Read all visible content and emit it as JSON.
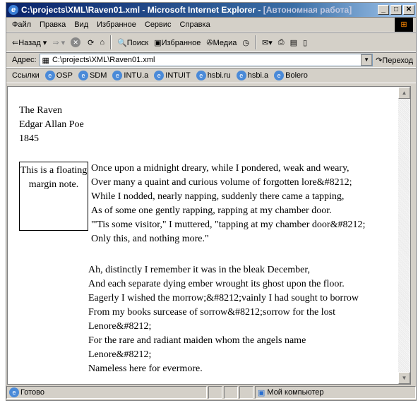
{
  "window": {
    "title": "C:\\projects\\XML\\Raven01.xml - Microsoft Internet Explorer - ",
    "title_suffix": "[Автономная работа]"
  },
  "menu": [
    "Файл",
    "Правка",
    "Вид",
    "Избранное",
    "Сервис",
    "Справка"
  ],
  "toolbar": {
    "back": "Назад",
    "search": "Поиск",
    "favorites": "Избранное",
    "media": "Медиа"
  },
  "address": {
    "label": "Адрес:",
    "value": "C:\\projects\\XML\\Raven01.xml",
    "go": "Переход"
  },
  "links": {
    "label": "Ссылки",
    "items": [
      "OSP",
      "SDM",
      "INTU.a",
      "INTUIT",
      "hsbi.ru",
      "hsbi.a",
      "Bolero"
    ]
  },
  "doc": {
    "title": "The Raven",
    "author": "Edgar Allan Poe",
    "year": "1845",
    "note": "This is a floating margin note.",
    "stanza1": [
      "Once upon a midnight dreary, while I pondered, weak and weary,",
      "Over many a quaint and curious volume of forgotten lore&#8212;",
      "While I nodded, nearly napping, suddenly there came a tapping,",
      "As of some one gently rapping, rapping at my chamber door.",
      "\"'Tis some visitor,\" I muttered, \"tapping at my chamber door&#8212;",
      "Only this, and nothing more.\""
    ],
    "stanza2": [
      "Ah, distinctly I remember it was in the bleak December,",
      "And each separate dying ember wrought its ghost upon the floor.",
      "Eagerly I wished the morrow;&#8212;vainly I had sought to borrow",
      "From my books surcease of sorrow&#8212;sorrow for the lost",
      "Lenore&#8212;",
      "For the rare and radiant maiden whom the angels name",
      "Lenore&#8212;",
      "Nameless here for evermore."
    ]
  },
  "status": {
    "text": "Готово",
    "zone": "Мой компьютер"
  }
}
